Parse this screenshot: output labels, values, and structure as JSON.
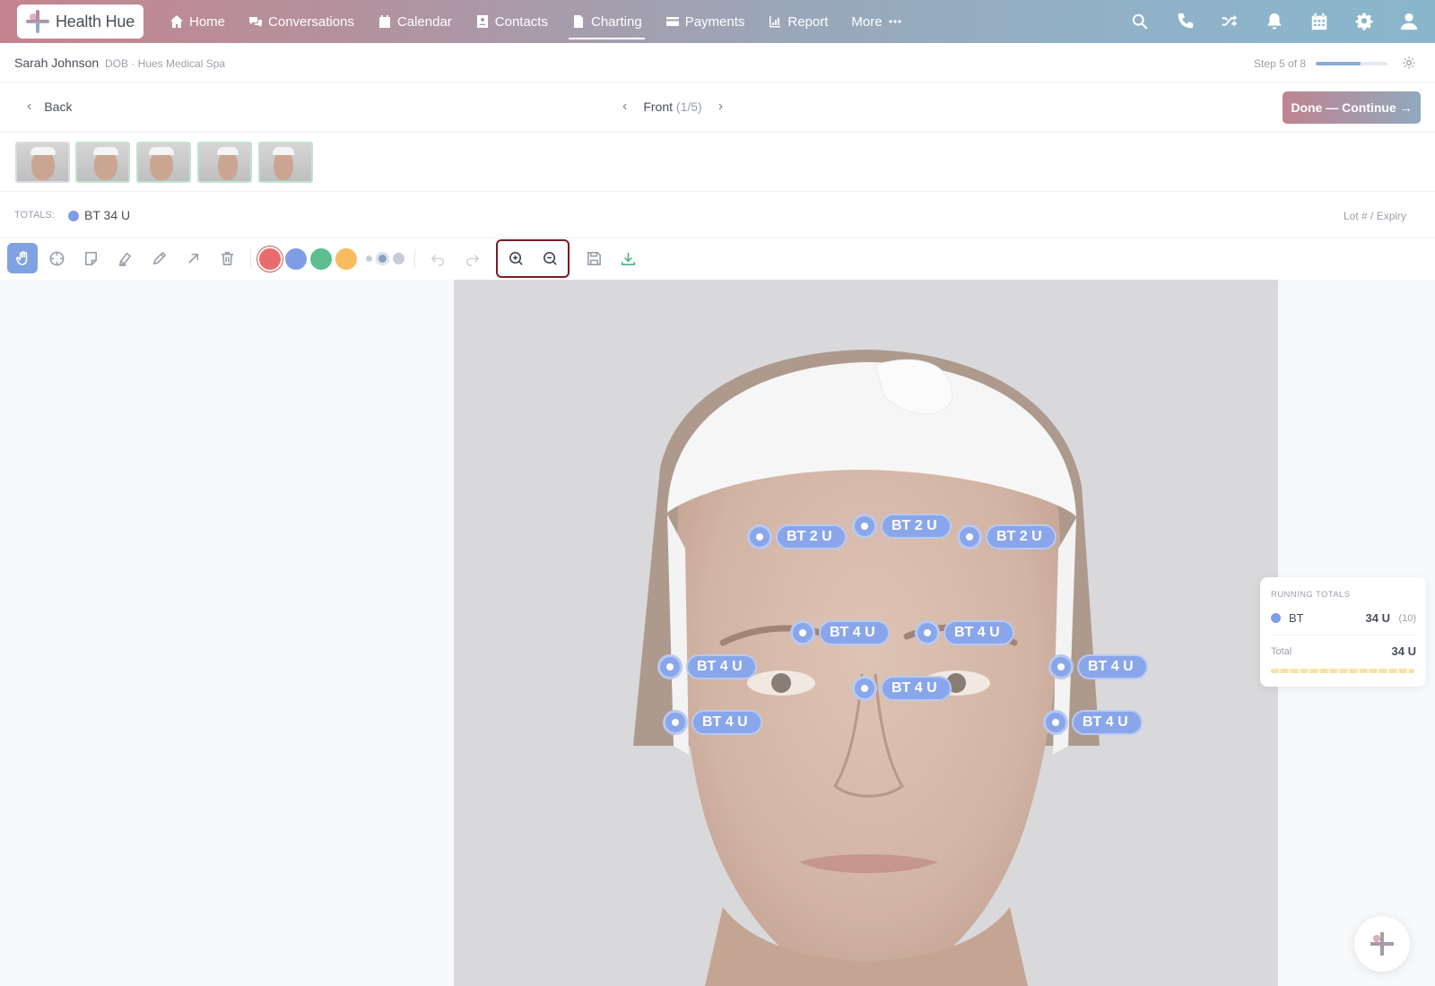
{
  "app": {
    "name": "Health Hue"
  },
  "nav": {
    "items": [
      {
        "label": "Home",
        "icon": "home-icon"
      },
      {
        "label": "Conversations",
        "icon": "chat-icon"
      },
      {
        "label": "Calendar",
        "icon": "calendar-icon"
      },
      {
        "label": "Contacts",
        "icon": "contacts-icon"
      },
      {
        "label": "Charting",
        "icon": "document-icon",
        "active": true
      },
      {
        "label": "Payments",
        "icon": "card-icon"
      },
      {
        "label": "Report",
        "icon": "report-icon"
      },
      {
        "label": "More",
        "icon": "more-dots-icon"
      }
    ],
    "right_icons": [
      "search-icon",
      "phone-icon",
      "shuffle-icon",
      "bell-icon",
      "calendar-icon",
      "gear-icon",
      "user-icon"
    ]
  },
  "patient": {
    "name": "Sarah Johnson",
    "meta": "DOB · Hues Medical Spa"
  },
  "progress": {
    "label": "Step 5 of 8",
    "fraction": 0.625
  },
  "back_label": "Back",
  "pager": {
    "view": "Front",
    "count": "(1/5)"
  },
  "done_label": "Done — Continue →",
  "totals": {
    "label": "TOTALS:",
    "value": "BT 34 U",
    "lot": "Lot # / Expiry"
  },
  "colors": {
    "red": "#ea6b6b",
    "blue": "#7e9de6",
    "green": "#5cbf8f",
    "orange": "#f7bc5e",
    "marker": "#8aa6ea"
  },
  "markers": [
    {
      "label": "BT 2 U"
    },
    {
      "label": "BT 2 U"
    },
    {
      "label": "BT 2 U"
    },
    {
      "label": "BT 4 U"
    },
    {
      "label": "BT 4 U"
    },
    {
      "label": "BT 4 U"
    },
    {
      "label": "BT 4 U"
    },
    {
      "label": "BT 4 U"
    },
    {
      "label": "BT 4 U"
    },
    {
      "label": "BT 4 U"
    }
  ],
  "running_totals": {
    "title": "RUNNING TOTALS",
    "product": "BT",
    "value": "34 U",
    "count": "(10)",
    "total_label": "Total",
    "total_value": "34 U"
  }
}
